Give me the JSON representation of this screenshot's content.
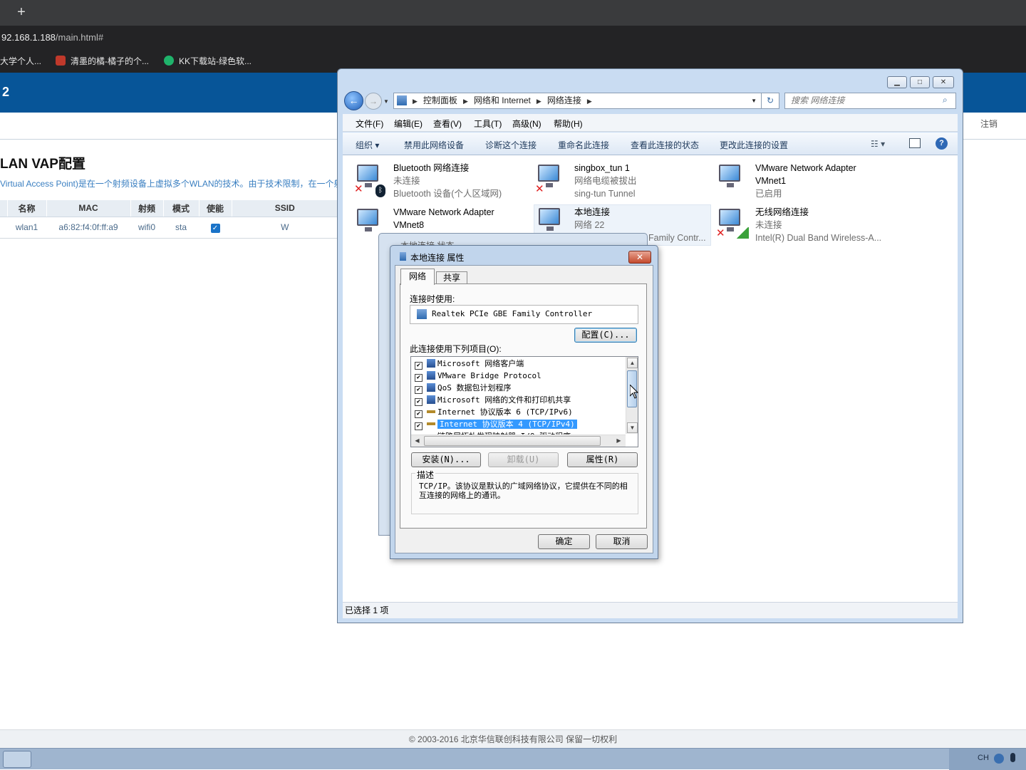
{
  "browser": {
    "new_tab": "+",
    "url_host": "92.168.1.188",
    "url_path": "/main.html#",
    "bookmarks": [
      "大学个人...",
      "清墨的橘-橘子的个...",
      "KK下载站-绿色软..."
    ]
  },
  "router": {
    "header_title": "2",
    "logout": "注销",
    "page_title": "LAN VAP配置",
    "page_desc": "Virtual Access Point)是在一个射频设备上虚拟多个WLAN的技术。由于技术限制，在一个射",
    "table_headers": [
      "名称",
      "MAC",
      "射频",
      "模式",
      "使能",
      "SSID"
    ],
    "table_rows": [
      {
        "name": "wlan1",
        "mac": "a6:82:f4:0f:ff:a9",
        "radio": "wifi0",
        "mode": "sta",
        "enabled": "✓",
        "ssid": "W"
      }
    ],
    "footer": "© 2003-2016 北京华信联创科技有限公司 保留一切权利"
  },
  "explorer": {
    "breadcrumb": [
      "控制面板",
      "网络和 Internet",
      "网络连接"
    ],
    "search_placeholder": "搜索 网络连接",
    "menu": [
      "文件(F)",
      "编辑(E)",
      "查看(V)",
      "工具(T)",
      "高级(N)",
      "帮助(H)"
    ],
    "commands": [
      "组织 ▾",
      "禁用此网络设备",
      "诊断这个连接",
      "重命名此连接",
      "查看此连接的状态",
      "更改此连接的设置"
    ],
    "adapters": [
      {
        "name": "Bluetooth 网络连接",
        "status": "未连接",
        "device": "Bluetooth 设备(个人区域网)"
      },
      {
        "name": "singbox_tun 1",
        "status": "网络电缆被拔出",
        "device": "sing-tun Tunnel"
      },
      {
        "name": "VMware Network Adapter",
        "status": "VMnet1",
        "device": "已启用"
      },
      {
        "name": "VMware Network Adapter",
        "status": "VMnet8",
        "device": ""
      },
      {
        "name": "本地连接",
        "status": "网络  22",
        "device": "Family Contr..."
      },
      {
        "name": "无线网络连接",
        "status": "未连接",
        "device": "Intel(R) Dual Band Wireless-A..."
      }
    ],
    "status_bar": "已选择 1 项"
  },
  "dialog": {
    "back_title": "本地连接 状态",
    "title": "本地连接 属性",
    "close": "✕",
    "tabs": [
      "网络",
      "共享"
    ],
    "connect_using_label": "连接时使用:",
    "adapter": "Realtek PCIe GBE Family Controller",
    "configure": "配置(C)...",
    "items_label": "此连接使用下列项目(O):",
    "items": [
      "Microsoft 网络客户端",
      "VMware Bridge Protocol",
      "QoS 数据包计划程序",
      "Microsoft 网络的文件和打印机共享",
      "Internet 协议版本 6 (TCP/IPv6)",
      "Internet 协议版本 4 (TCP/IPv4)",
      "链路层拓扑发现映射器 I/O 驱动程序"
    ],
    "install": "安装(N)...",
    "uninstall": "卸载(U)",
    "properties": "属性(R)",
    "desc_label": "描述",
    "desc_text": "TCP/IP。该协议是默认的广域网络协议，它提供在不同的相互连接的网络上的通讯。",
    "ok": "确定",
    "cancel": "取消"
  },
  "taskbar": {
    "lang": "CH"
  },
  "colors": {
    "router_header": "#075598",
    "selection": "#3399ff",
    "close_red": "#c44a2c"
  }
}
